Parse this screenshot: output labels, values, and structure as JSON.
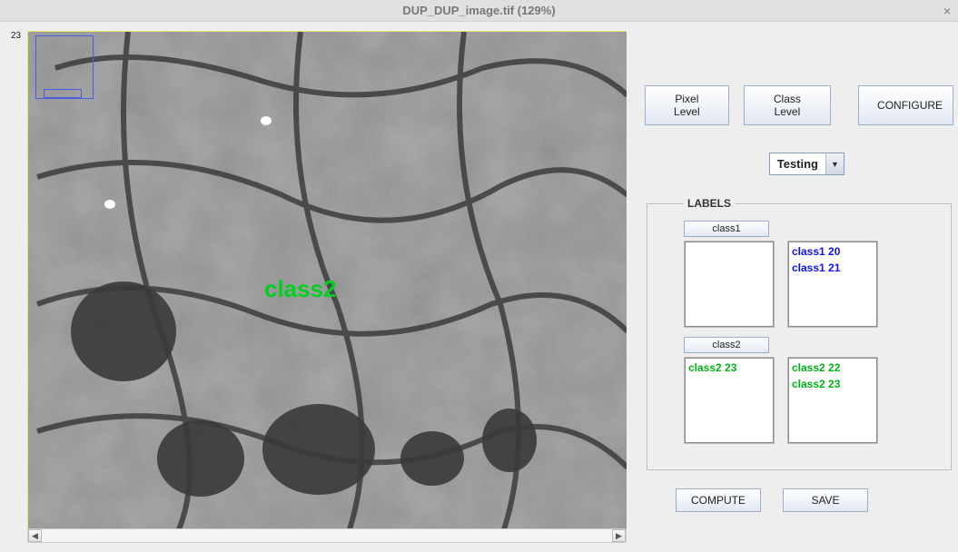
{
  "titlebar": {
    "title": "DUP_DUP_image.tif (129%)",
    "close_glyph": "×"
  },
  "ruler_label": "23",
  "overlay": {
    "class2_text": "class2"
  },
  "toolbar": {
    "pixel_level": "Pixel Level",
    "class_level": "Class Level",
    "configure": "CONFIGURE"
  },
  "mode_select": {
    "value": "Testing"
  },
  "labels_panel": {
    "legend": "LABELS",
    "class1_btn": "class1",
    "class2_btn": "class2",
    "class1_left": [],
    "class1_right": [
      "class1 20",
      "class1 21"
    ],
    "class2_left": [
      "class2 23"
    ],
    "class2_right": [
      "class2 22",
      "class2 23"
    ]
  },
  "bottom": {
    "compute": "COMPUTE",
    "save": "SAVE"
  }
}
